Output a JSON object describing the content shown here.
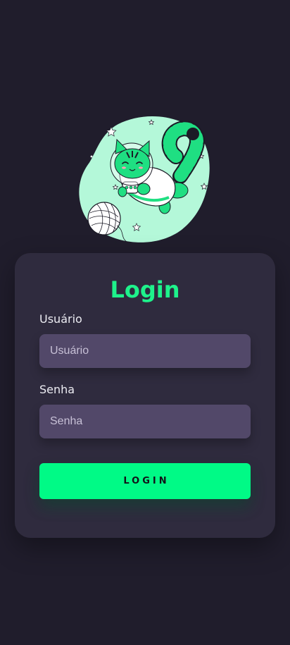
{
  "header": {
    "illustration_icon": "astronaut-cat-illustration"
  },
  "login_form": {
    "title": "Login",
    "username": {
      "label": "Usuário",
      "placeholder": "Usuário",
      "value": ""
    },
    "password": {
      "label": "Senha",
      "placeholder": "Senha",
      "value": ""
    },
    "submit_label": "LOGIN"
  },
  "colors": {
    "background": "#201d2c",
    "card": "#2f2b3e",
    "accent": "#00fa86",
    "title": "#1ef28b",
    "input_background": "#524869"
  }
}
